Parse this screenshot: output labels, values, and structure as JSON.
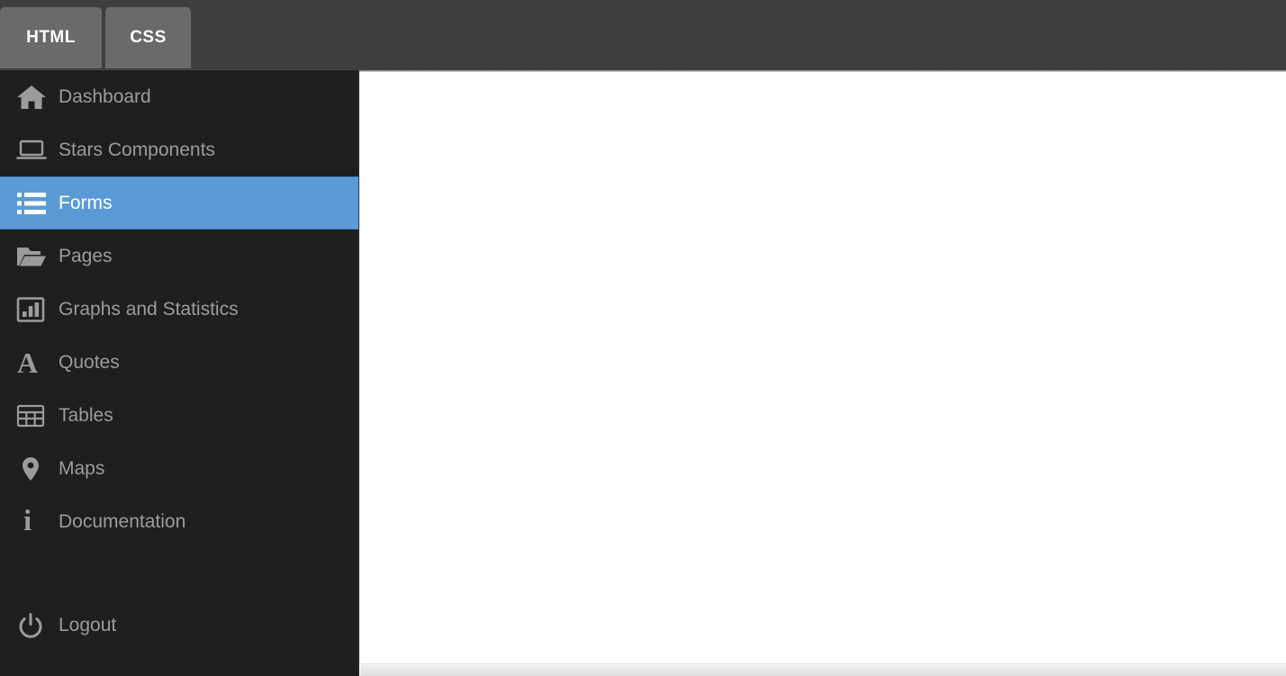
{
  "colors": {
    "topbar_bg": "#3e3e40",
    "tab_bg": "#6a6a6c",
    "sidebar_bg": "#1e1e1e",
    "sidebar_text": "#9b9b9b",
    "active_accent": "#5b9bd5",
    "active_text": "#ffffff",
    "content_bg": "#ffffff"
  },
  "topbar": {
    "tabs": [
      {
        "label": "HTML",
        "name": "tab-html",
        "active": true
      },
      {
        "label": "CSS",
        "name": "tab-css",
        "active": false
      }
    ]
  },
  "sidebar": {
    "items": [
      {
        "label": "Dashboard",
        "icon": "home-icon",
        "active": false
      },
      {
        "label": "Stars Components",
        "icon": "laptop-icon",
        "active": false
      },
      {
        "label": "Forms",
        "icon": "list-icon",
        "active": true
      },
      {
        "label": "Pages",
        "icon": "folder-open-icon",
        "active": false
      },
      {
        "label": "Graphs and Statistics",
        "icon": "bar-chart-icon",
        "active": false
      },
      {
        "label": "Quotes",
        "icon": "typography-icon",
        "active": false
      },
      {
        "label": "Tables",
        "icon": "table-icon",
        "active": false
      },
      {
        "label": "Maps",
        "icon": "map-pin-icon",
        "active": false
      },
      {
        "label": "Documentation",
        "icon": "info-icon",
        "active": false
      }
    ],
    "footer": [
      {
        "label": "Logout",
        "icon": "power-icon"
      }
    ]
  },
  "main": {
    "body_text": ""
  }
}
